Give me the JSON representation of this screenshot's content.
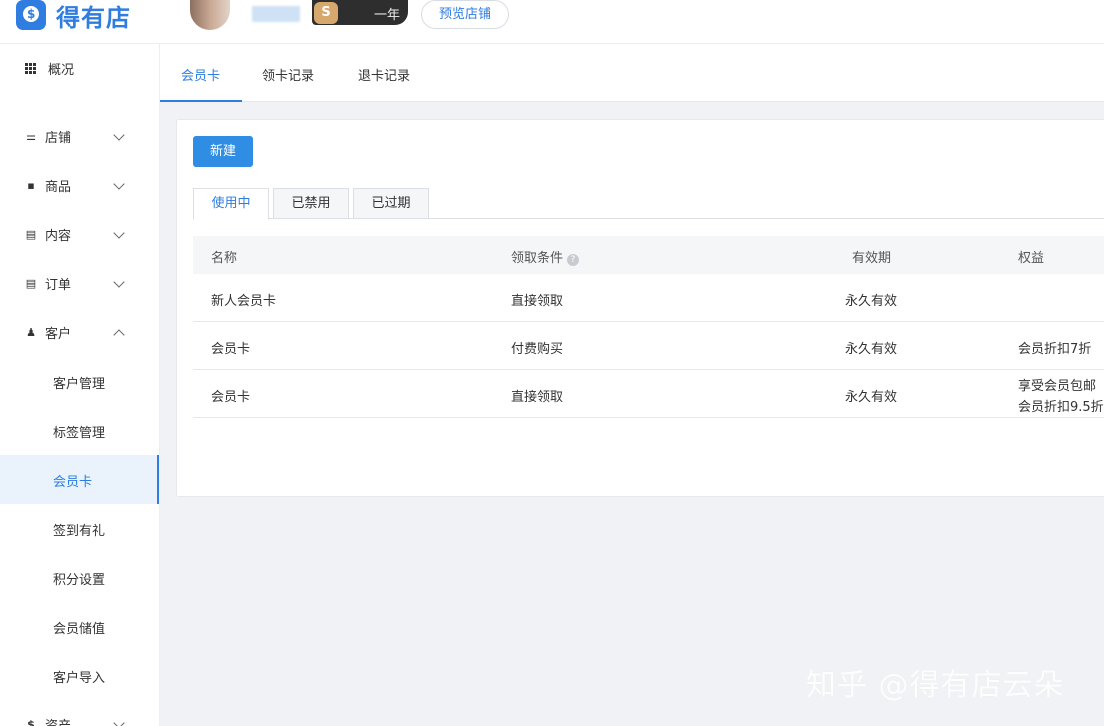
{
  "app": {
    "logo_icon": "dollar-shop-icon",
    "logo_text": "得有店"
  },
  "header": {
    "level_badge": "S",
    "level_text": "一年",
    "preview_label": "预览店铺"
  },
  "sidebar": {
    "overview": "概况",
    "groups": [
      {
        "label": "店铺",
        "icon": "store-icon"
      },
      {
        "label": "商品",
        "icon": "goods-icon"
      },
      {
        "label": "内容",
        "icon": "content-icon"
      },
      {
        "label": "订单",
        "icon": "order-icon"
      },
      {
        "label": "客户",
        "icon": "customer-icon"
      }
    ],
    "customer_items": [
      "客户管理",
      "标签管理",
      "会员卡",
      "签到有礼",
      "积分设置",
      "会员储值",
      "客户导入"
    ],
    "assets": "资产"
  },
  "tabs": [
    "会员卡",
    "领卡记录",
    "退卡记录"
  ],
  "panel": {
    "new_button": "新建",
    "status_tabs": [
      "使用中",
      "已禁用",
      "已过期"
    ],
    "columns": [
      "名称",
      "领取条件",
      "有效期",
      "权益"
    ],
    "help_glyph": "?",
    "rows": [
      {
        "name": "新人会员卡",
        "condition": "直接领取",
        "validity": "永久有效",
        "benefit1": "",
        "benefit2": ""
      },
      {
        "name": "会员卡",
        "condition": "付费购买",
        "validity": "永久有效",
        "benefit1": "会员折扣7折",
        "benefit2": ""
      },
      {
        "name": "会员卡",
        "condition": "直接领取",
        "validity": "永久有效",
        "benefit1": "享受会员包邮",
        "benefit2": "会员折扣9.5折"
      }
    ]
  },
  "watermark": "知乎 @得有店云朵"
}
